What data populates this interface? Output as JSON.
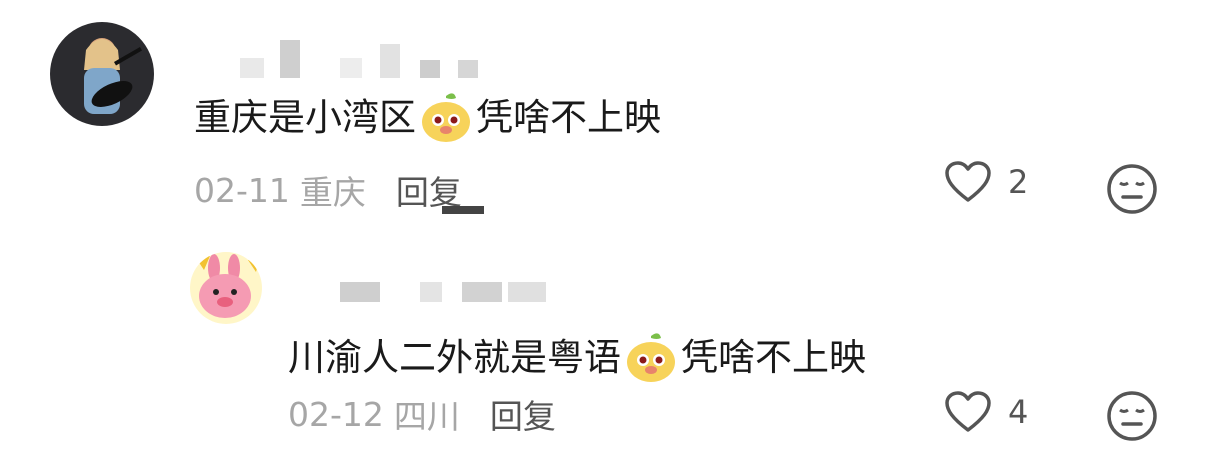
{
  "comments": [
    {
      "text_before": "重庆是小湾区",
      "text_after": "凭啥不上映",
      "date": "02-11",
      "location": "重庆",
      "reply_label": "回复",
      "likes": "2"
    },
    {
      "text_before": "川渝人二外就是粤语",
      "text_after": "凭啥不上映",
      "date": "02-12",
      "location": "四川",
      "reply_label": "回复",
      "likes": "4"
    }
  ],
  "icons": {
    "like": "heart-outline-icon",
    "dislike": "meh-face-icon",
    "emoji": "yellow-dog-emoji"
  },
  "colors": {
    "text": "#1a1a1a",
    "meta": "#a6a6a6",
    "action": "#555555"
  }
}
